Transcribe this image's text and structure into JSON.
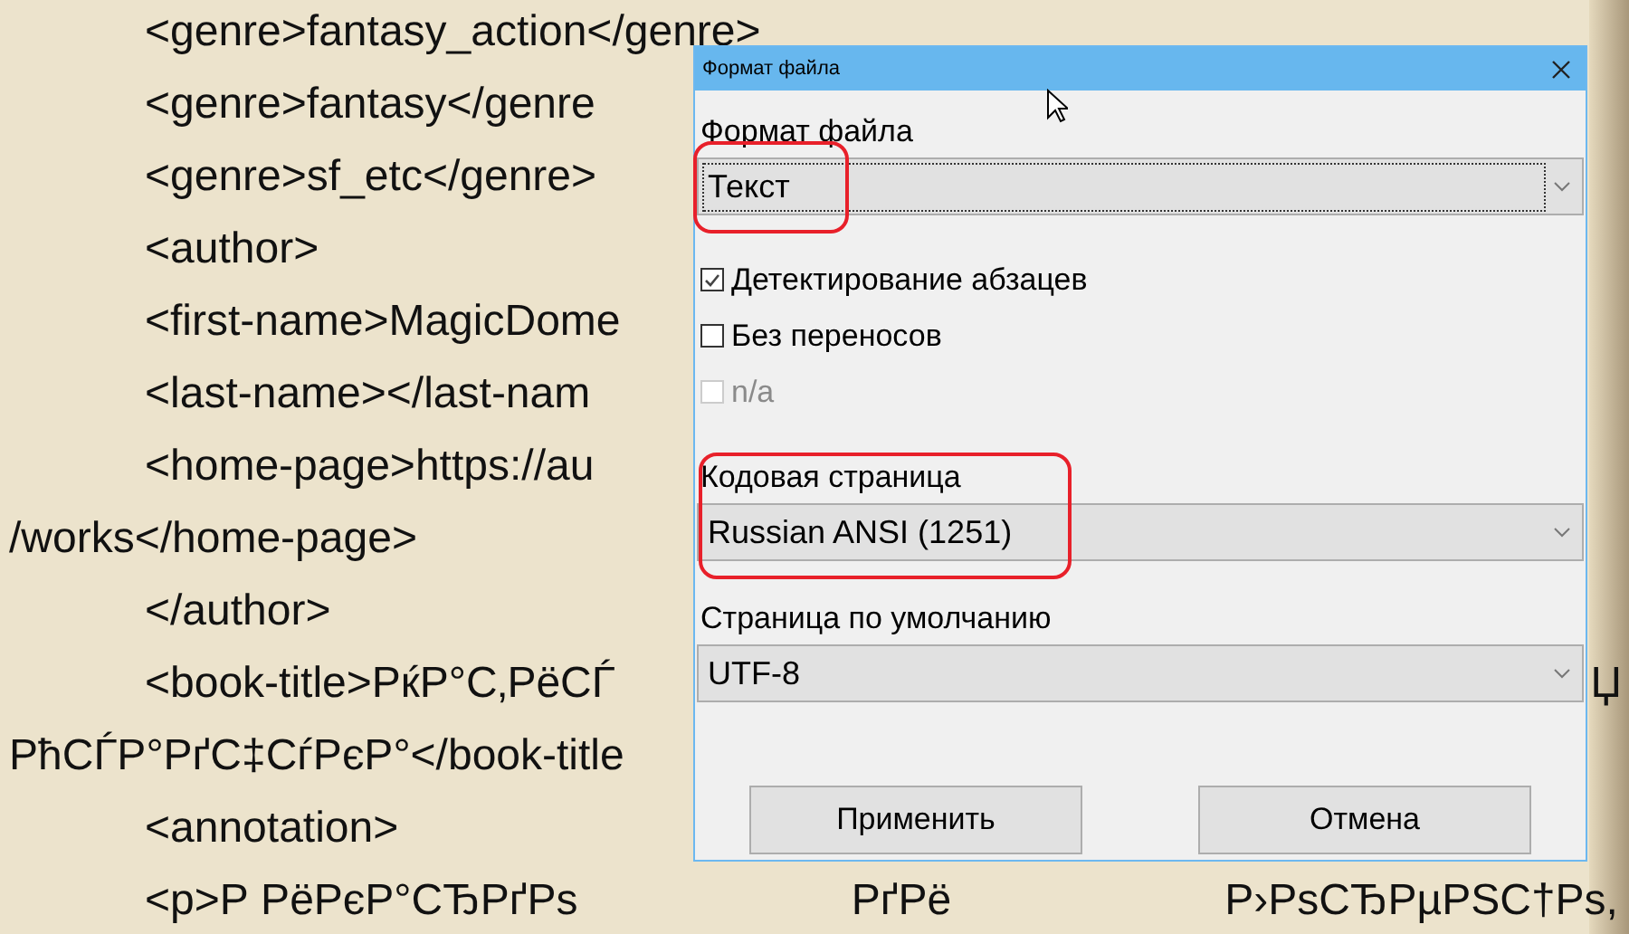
{
  "document": {
    "lines": [
      {
        "indent": true,
        "segments": [
          "<genre>fantasy_action</genre>"
        ]
      },
      {
        "indent": true,
        "segments": [
          "<genre>fantasy</genre"
        ]
      },
      {
        "indent": true,
        "segments": [
          "<genre>sf_etc</genre>"
        ]
      },
      {
        "indent": true,
        "segments": [
          "<author>"
        ]
      },
      {
        "indent": true,
        "segments": [
          "<first-name>MagicDome"
        ]
      },
      {
        "indent": true,
        "segments": [
          "<last-name></last-nam"
        ]
      },
      {
        "indent": true,
        "segments": [
          "<home-page>https://au"
        ]
      },
      {
        "indent": false,
        "segments": [
          "/works</home-page>"
        ]
      },
      {
        "indent": true,
        "segments": [
          "</author>"
        ]
      },
      {
        "indent": true,
        "segments": [
          "<book-title>РќР°С‚РёСЃ",
          "Џ"
        ]
      },
      {
        "indent": false,
        "segments": [
          "РћСЃР°РґС‡СѓРєР°</book-title"
        ]
      },
      {
        "indent": true,
        "segments": [
          "<annotation>"
        ]
      },
      {
        "indent": true,
        "segments": [
          "<p>Р РёРєР°СЂРґРѕ",
          "РґРё",
          "Р›РѕСЂРµРЅС†Рѕ,"
        ]
      }
    ]
  },
  "dialog": {
    "title": "Формат файла",
    "controls": [
      {
        "kind": "select",
        "label": "Формат файла",
        "value": "Текст",
        "focused": true,
        "label_circled": false,
        "value_circled": true
      },
      {
        "kind": "checkbox",
        "label": "Детектирование абзацев",
        "checked": true,
        "disabled": false
      },
      {
        "kind": "checkbox",
        "label": "Без переносов",
        "checked": false,
        "disabled": false
      },
      {
        "kind": "checkbox",
        "label": "n/a",
        "checked": false,
        "disabled": true
      },
      {
        "kind": "select",
        "label": "Кодовая страница",
        "value": "Russian ANSI (1251)",
        "focused": false,
        "label_circled": true,
        "value_circled": true
      },
      {
        "kind": "select",
        "label": "Страница по умолчанию",
        "value": "UTF-8",
        "focused": false,
        "label_circled": false,
        "value_circled": false
      }
    ],
    "buttons": [
      "Применить",
      "Отмена"
    ]
  }
}
